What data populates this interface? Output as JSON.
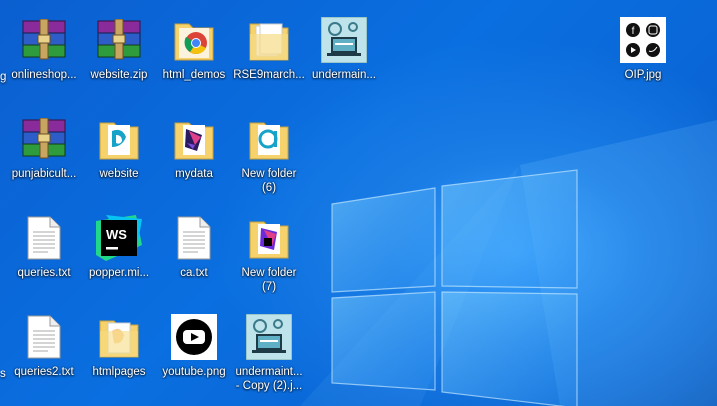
{
  "desktop": {
    "edge_labels": [
      "g",
      "s"
    ],
    "icons": [
      {
        "label": "onlineshop...",
        "icon": "winrar-archive-icon"
      },
      {
        "label": "website.zip",
        "icon": "winrar-archive-icon"
      },
      {
        "label": "html_demos",
        "icon": "chrome-folder-icon"
      },
      {
        "label": "RSE9march...",
        "icon": "folder-icon"
      },
      {
        "label": "undermain...",
        "icon": "image-thumbnail-icon"
      },
      {
        "label": "OIP.jpg",
        "icon": "social-media-image-icon"
      },
      {
        "label": "punjabicult...",
        "icon": "winrar-archive-icon"
      },
      {
        "label": "website",
        "icon": "folder-app-icon"
      },
      {
        "label": "mydata",
        "icon": "folder-app-icon"
      },
      {
        "label": "New folder\n(6)",
        "icon": "folder-app-icon"
      },
      {
        "label": "queries.txt",
        "icon": "text-file-icon"
      },
      {
        "label": "popper.mi...",
        "icon": "webstorm-icon"
      },
      {
        "label": "ca.txt",
        "icon": "text-file-icon"
      },
      {
        "label": "New folder\n(7)",
        "icon": "folder-app-icon"
      },
      {
        "label": "queries2.txt",
        "icon": "text-file-icon"
      },
      {
        "label": "htmlpages",
        "icon": "folder-icon"
      },
      {
        "label": "youtube.png",
        "icon": "youtube-image-icon"
      },
      {
        "label": "undermaint...\n- Copy (2).j...",
        "icon": "image-thumbnail-icon"
      }
    ]
  },
  "colors": {
    "wallpaper_dark": "#0653b8",
    "wallpaper_light": "#3aa3ff",
    "folder": "#f5d26b"
  }
}
